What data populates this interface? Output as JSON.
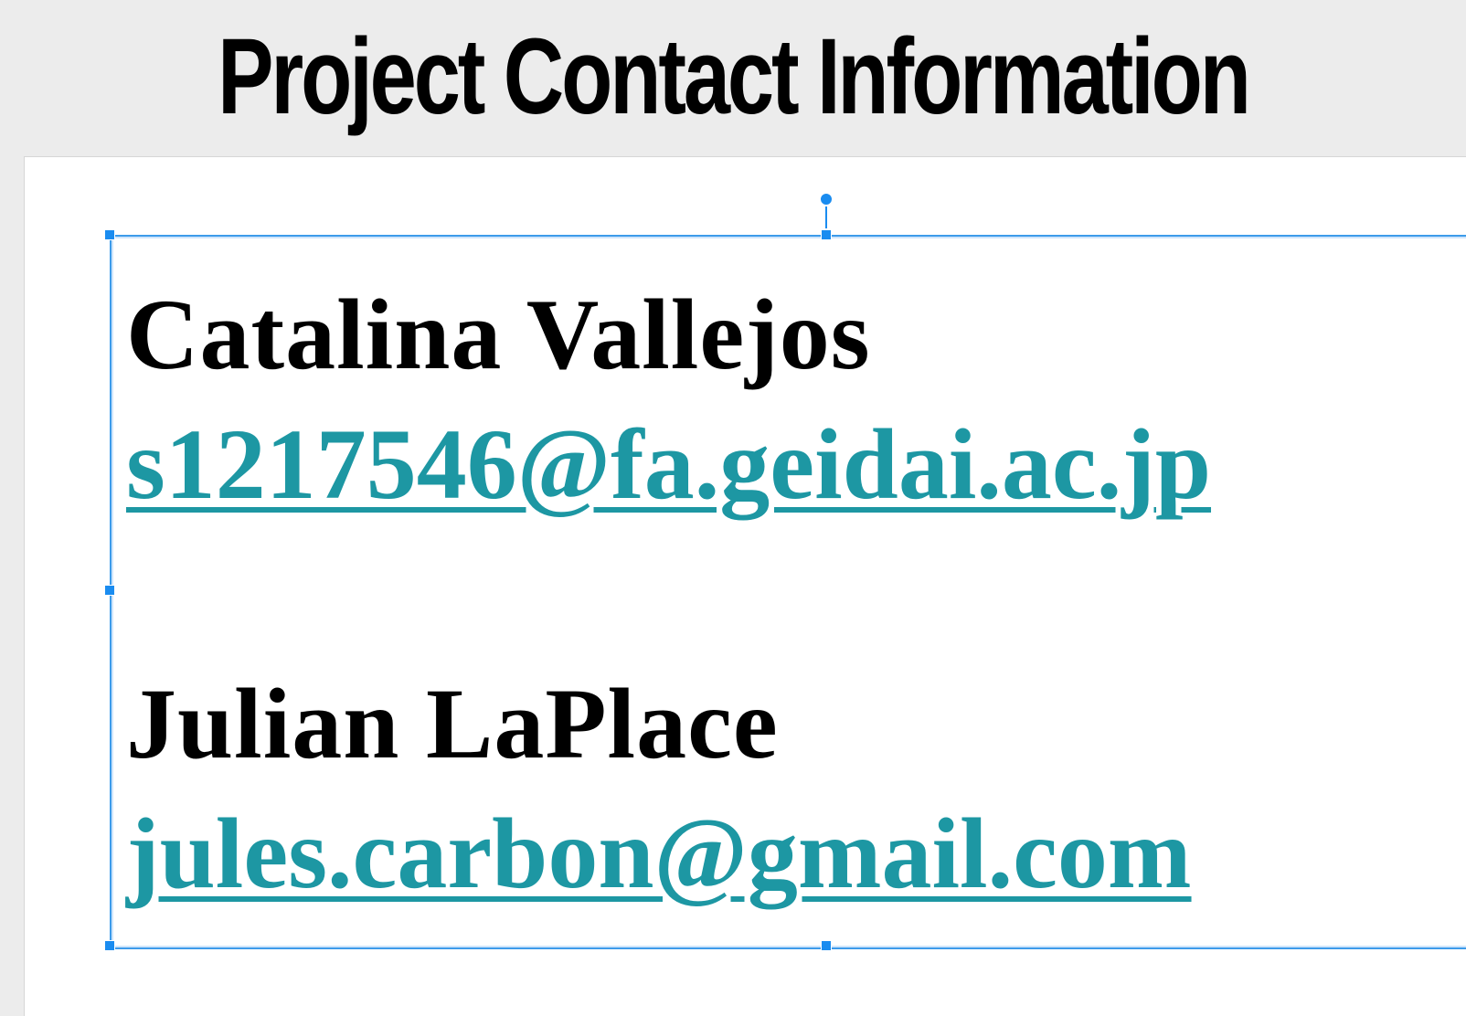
{
  "title": "Project Contact Information",
  "contacts": [
    {
      "name": "Catalina Vallejos",
      "email": "s1217546@fa.geidai.ac.jp"
    },
    {
      "name": "Julian LaPlace",
      "email": "jules.carbon@gmail.com"
    }
  ],
  "colors": {
    "link": "#1d97a3",
    "selection": "#1a8cf0",
    "canvas_background": "#ececec",
    "slide_background": "#ffffff"
  }
}
